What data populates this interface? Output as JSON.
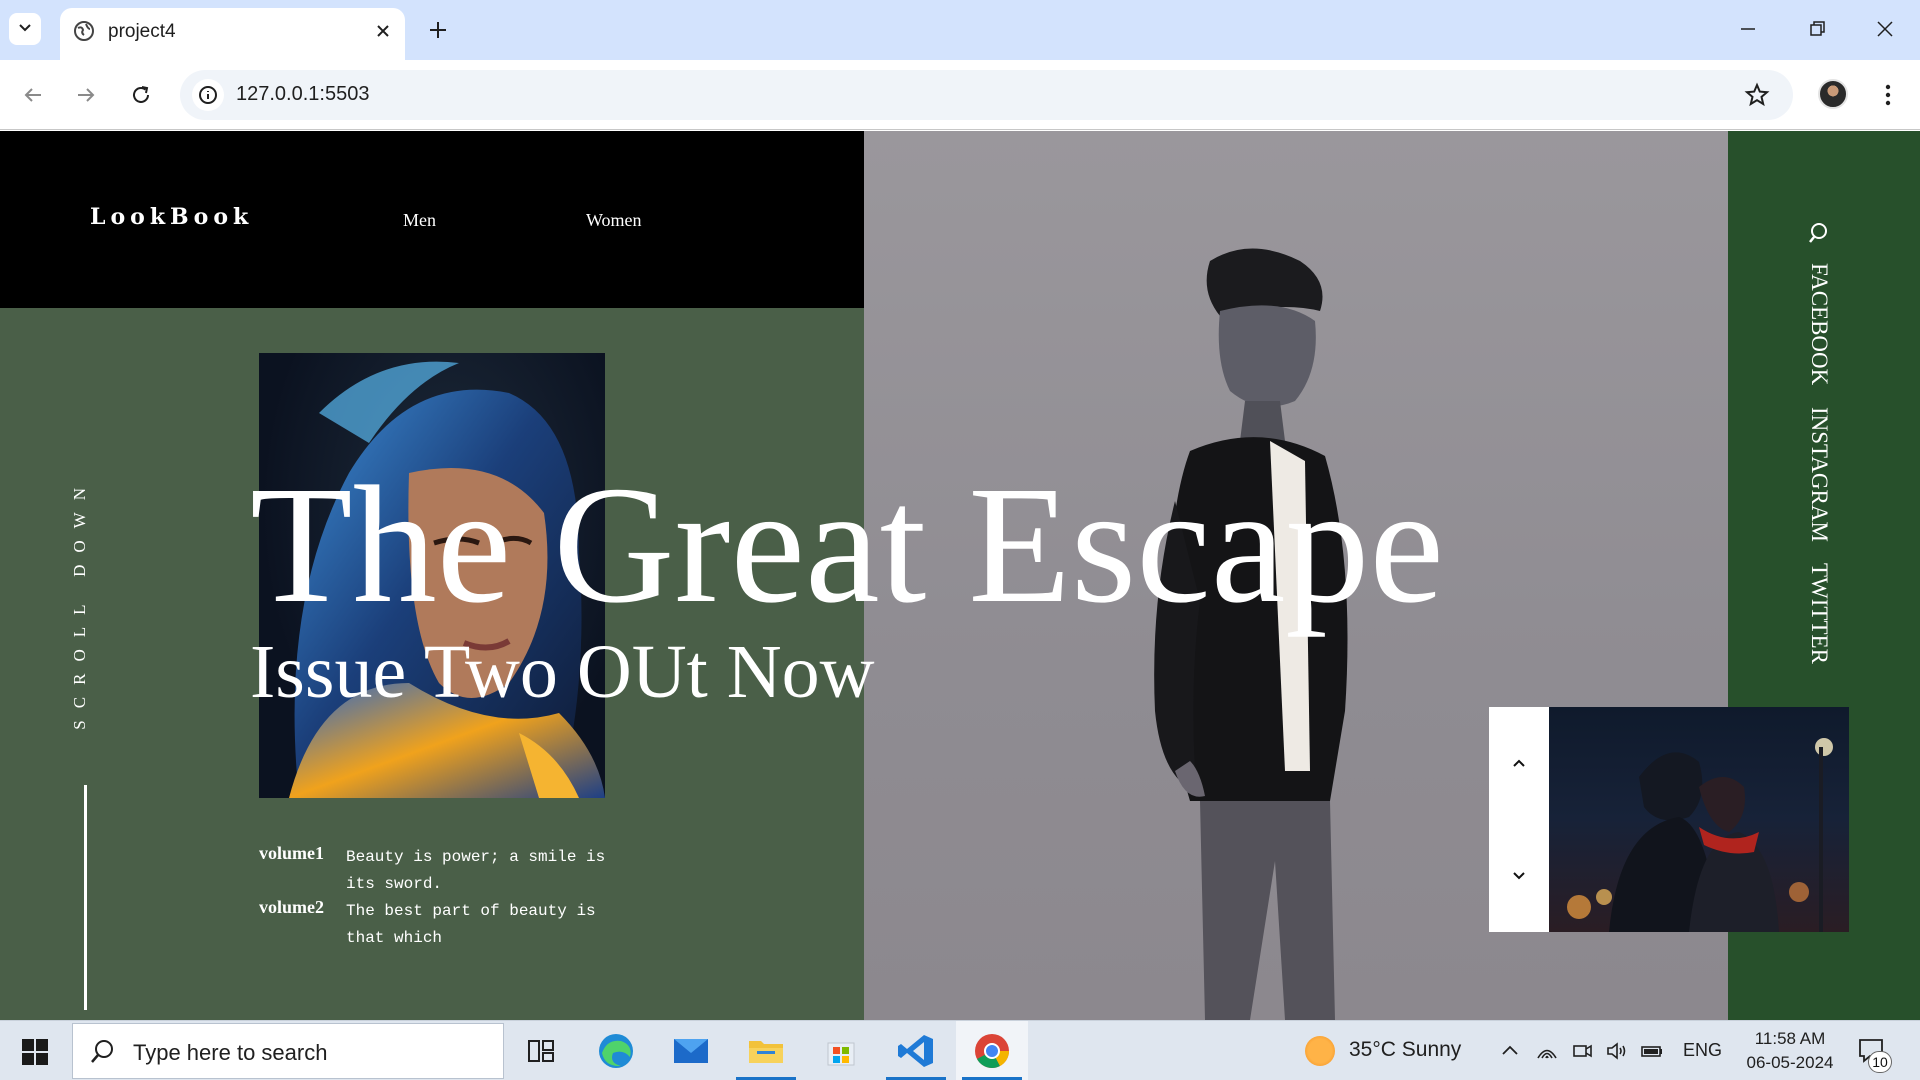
{
  "browser": {
    "tab_title": "project4",
    "url": "127.0.0.1:5503"
  },
  "site": {
    "brand": "LookBook",
    "nav": [
      "Men",
      "Women"
    ],
    "scroll_label": "SCROLL DOWN",
    "social": [
      "FACEBOOK",
      "INSTAGRAM",
      "TWITTER"
    ],
    "hero_title": "The Great Escape",
    "hero_subtitle": "Issue Two OUt Now",
    "volumes": [
      {
        "label": "volume1",
        "text": "Beauty is power; a smile is its sword."
      },
      {
        "label": "volume2",
        "text": "The best part of beauty is that which"
      }
    ]
  },
  "taskbar": {
    "search_placeholder": "Type here to search",
    "weather": "35°C  Sunny",
    "language": "ENG",
    "time": "11:58 AM",
    "date": "06-05-2024",
    "notification_count": "10"
  },
  "colors": {
    "accent_green_left": "#4a5f48",
    "accent_green_right": "#27502b",
    "hero_gray": "#9a979c",
    "tabstrip": "#d3e3fd"
  }
}
